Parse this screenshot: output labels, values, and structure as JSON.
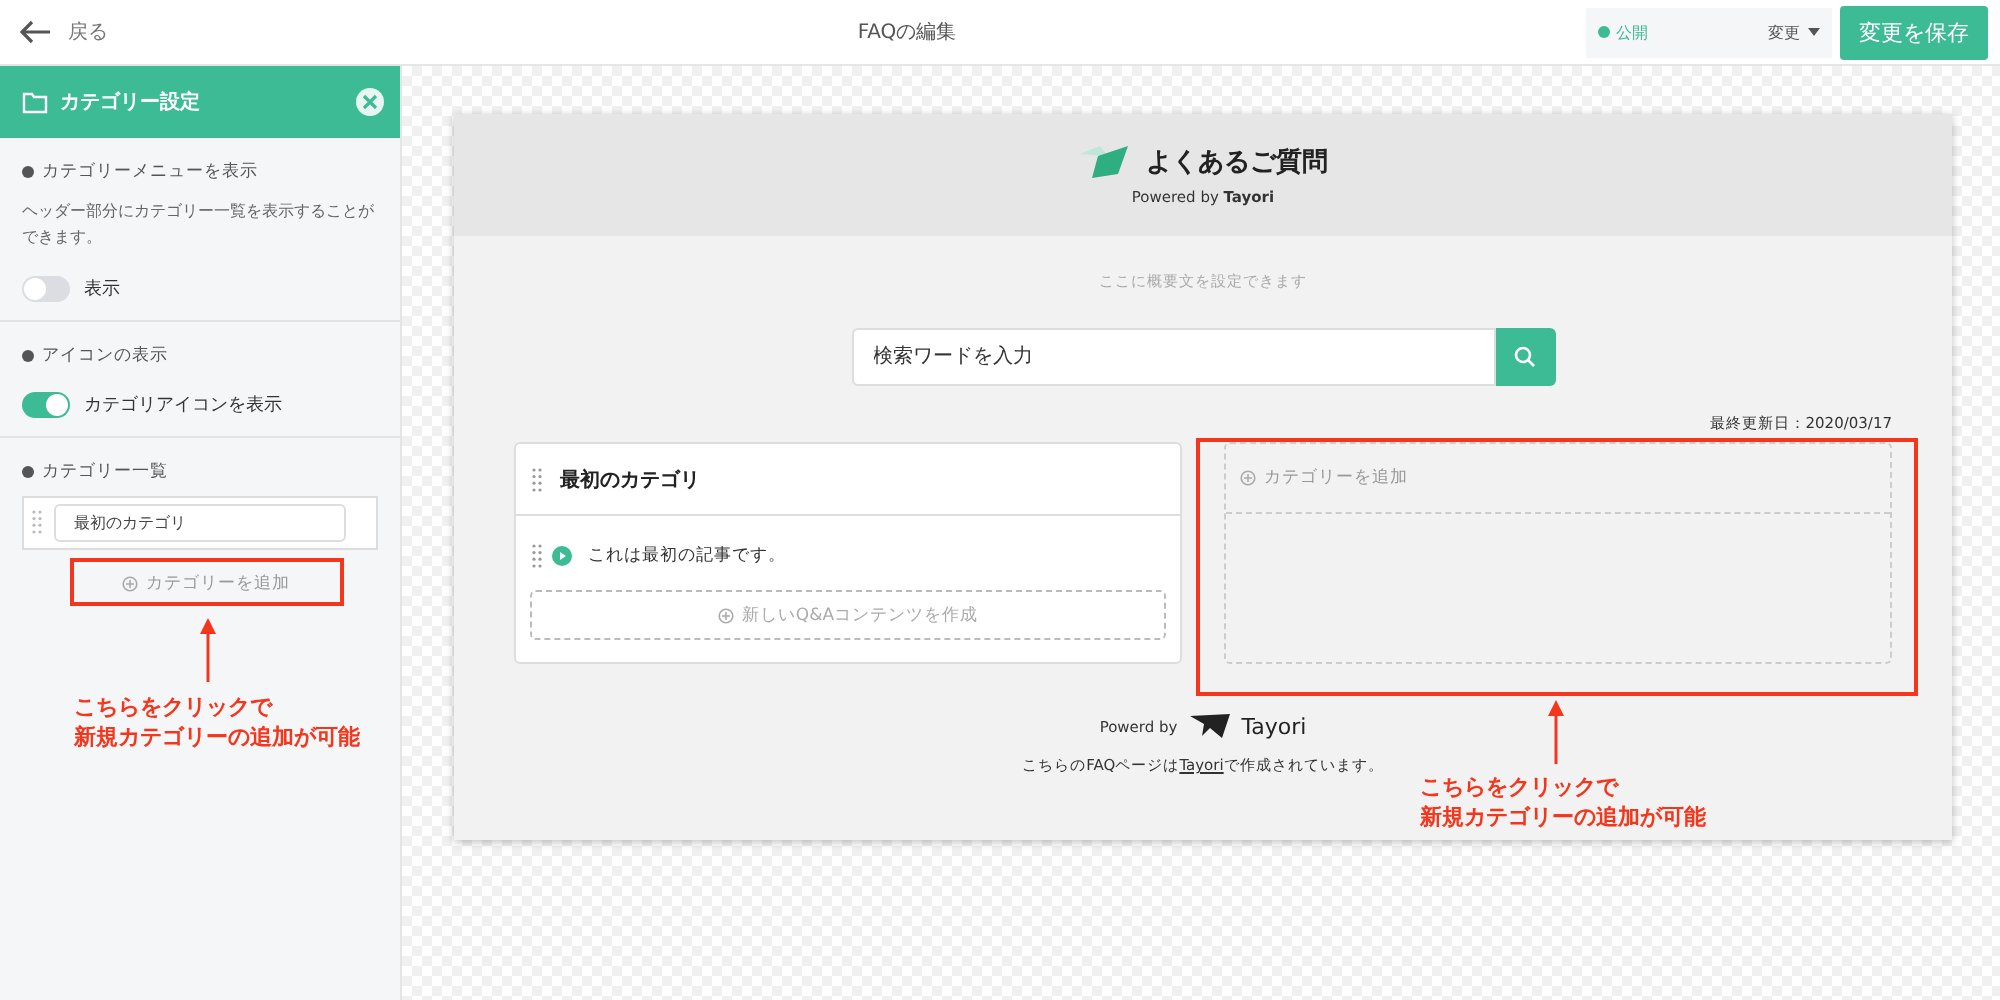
{
  "topbar": {
    "back": "戻る",
    "title": "FAQの編集",
    "status": "公開",
    "change": "変更",
    "save": "変更を保存"
  },
  "sidebar": {
    "title": "カテゴリー設定",
    "sections": [
      {
        "kind": "toggle",
        "heading": "カテゴリーメニューを表示",
        "description": "ヘッダー部分にカテゴリー一覧を表示することができます。",
        "label": "表示",
        "on": false
      },
      {
        "kind": "toggle",
        "heading": "アイコンの表示",
        "label": "カテゴリアイコンを表示",
        "on": true
      },
      {
        "kind": "list",
        "heading": "カテゴリー一覧",
        "items": [
          "最初のカテゴリ"
        ],
        "add": "カテゴリーを追加"
      }
    ]
  },
  "preview": {
    "title": "よくあるご質問",
    "powered_prefix": "Powered by",
    "powered_brand": "Tayori",
    "summary": "ここに概要文を設定できます",
    "search_placeholder": "検索ワードを入力",
    "updated": "最終更新日：2020/03/17",
    "category": {
      "name": "最初のカテゴリ",
      "articles": [
        "これは最初の記事です。"
      ],
      "new": "新しいQ&Aコンテンツを作成"
    },
    "add_category": "カテゴリーを追加",
    "footer_powered": "Powerd by",
    "footer_brand": "Tayori",
    "footer_before": "こちらのFAQページは",
    "footer_link": "Tayori",
    "footer_after": "で作成されています。"
  },
  "annotations": [
    {
      "text": [
        "こちらをクリックで",
        "新規カテゴリーの追加が可能"
      ]
    },
    {
      "text": [
        "こちらをクリックで",
        "新規カテゴリーの追加が可能"
      ]
    }
  ]
}
